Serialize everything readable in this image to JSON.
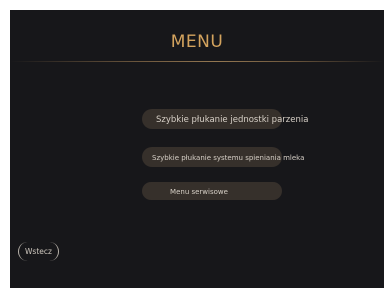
{
  "header": {
    "title": "MENU"
  },
  "menu": {
    "items": [
      {
        "label": "Szybkie płukanie jednostki parzenia"
      },
      {
        "label": "Szybkie płukanie systemu spieniania mleka"
      },
      {
        "label": "Menu serwisowe"
      }
    ]
  },
  "footer": {
    "back_label": "Wstecz"
  },
  "colors": {
    "background": "#17171a",
    "accent": "#d3a35e",
    "button": "#36302b",
    "text": "#d6cfc6"
  }
}
